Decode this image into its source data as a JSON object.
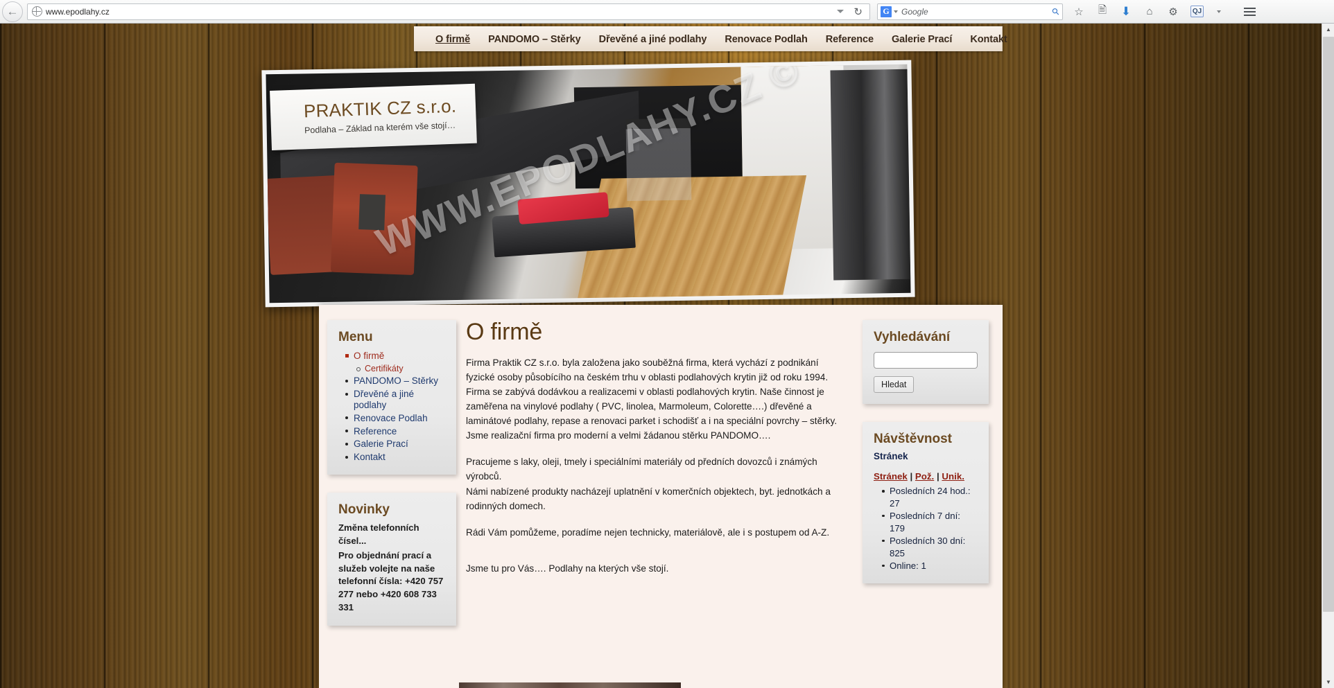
{
  "browser": {
    "back_icon": "back-arrow-icon",
    "url": "www.epodlahy.cz",
    "reload_icon": "reload-icon",
    "search_engine": "G",
    "search_placeholder": "Google",
    "search_value": "",
    "toolbar_icons": [
      "bookmark-star-icon",
      "reader-list-icon",
      "download-arrow-icon",
      "home-icon",
      "settings-gear-icon",
      "qj-addon-icon",
      "menu-hamburger-icon"
    ],
    "addon_label": "QJ"
  },
  "topnav": {
    "items": [
      {
        "label": "O firmě",
        "active": true
      },
      {
        "label": "PANDOMO – Stěrky",
        "active": false
      },
      {
        "label": "Dřevěné a jiné podlahy",
        "active": false
      },
      {
        "label": "Renovace Podlah",
        "active": false
      },
      {
        "label": "Reference",
        "active": false
      },
      {
        "label": "Galerie Prací",
        "active": false
      },
      {
        "label": "Kontakt",
        "active": false
      }
    ]
  },
  "hero": {
    "logo_title": "PRAKTIK CZ s.r.o.",
    "logo_subtitle": "Podlaha – Základ na kterém vše stojí…",
    "watermark": "WWW.EPODLAHY.CZ ©"
  },
  "sidebar_left": {
    "menu": {
      "title": "Menu",
      "items": [
        {
          "label": "O firmě",
          "state": "current",
          "level": 1
        },
        {
          "label": "Certifikáty",
          "state": "sub",
          "level": 2
        },
        {
          "label": "PANDOMO – Stěrky",
          "state": "link",
          "level": 1
        },
        {
          "label": "Dřevěné a jiné podlahy",
          "state": "link",
          "level": 1
        },
        {
          "label": "Renovace Podlah",
          "state": "link",
          "level": 1
        },
        {
          "label": "Reference",
          "state": "link",
          "level": 1
        },
        {
          "label": "Galerie Prací",
          "state": "link",
          "level": 1
        },
        {
          "label": "Kontakt",
          "state": "link",
          "level": 1
        }
      ]
    },
    "novinky": {
      "title": "Novinky",
      "headline": "Změna telefonních čísel...",
      "body": "Pro objednání prací a služeb volejte na naše telefonní čísla: +420 757 277 nebo +420 608 733 331"
    }
  },
  "main": {
    "heading": "O firmě",
    "paragraphs": [
      "Firma Praktik CZ s.r.o.  byla založena  jako souběžná firma, která vychází  z podnikání fyzické osoby působícího na českém trhu v oblasti podlahových krytin již od roku 1994.",
      "Firma se zabývá dodávkou a realizacemi v oblasti podlahových krytin. Naše činnost je zaměřena na vinylové podlahy ( PVC, linolea, Marmoleum, Colorette….) dřevěné a laminátové podlahy, repase a renovaci parket i schodišť a i na speciální povrchy – stěrky.",
      "Jsme realizační firma pro moderní a velmi žádanou stěrku PANDOMO….",
      "Pracujeme s laky, oleji, tmely i speciálními materiály od předních dovozců i známých výrobců.",
      "Námi nabízené produkty nacházejí uplatnění v komerčních objektech, byt. jednotkách  a rodinných  domech.",
      "Rádi Vám pomůžeme, poradíme nejen technicky, materiálově, ale i s postupem od A-Z.",
      "Jsme tu pro Vás…. Podlahy na kterých vše stojí."
    ]
  },
  "sidebar_right": {
    "search": {
      "title": "Vyhledávání",
      "value": "",
      "placeholder": "",
      "button_label": "Hledat"
    },
    "stats": {
      "title": "Návštěvnost",
      "subtitle": "Stránek",
      "links": [
        "Stránek",
        "Pož.",
        "Unik."
      ],
      "separator": "|",
      "rows": [
        "Posledních 24 hod.: 27",
        "Posledních 7 dní: 179",
        "Posledních 30 dní: 825",
        "Online: 1"
      ]
    }
  },
  "colors": {
    "nav_text": "#3b2b1d",
    "heading_brown": "#5a3a14",
    "link_blue": "#1f3a6e",
    "current_red": "#9e2a1c",
    "content_bg": "#faf1ec",
    "box_bg": "#ededed",
    "wood": "#6f4a1d"
  }
}
